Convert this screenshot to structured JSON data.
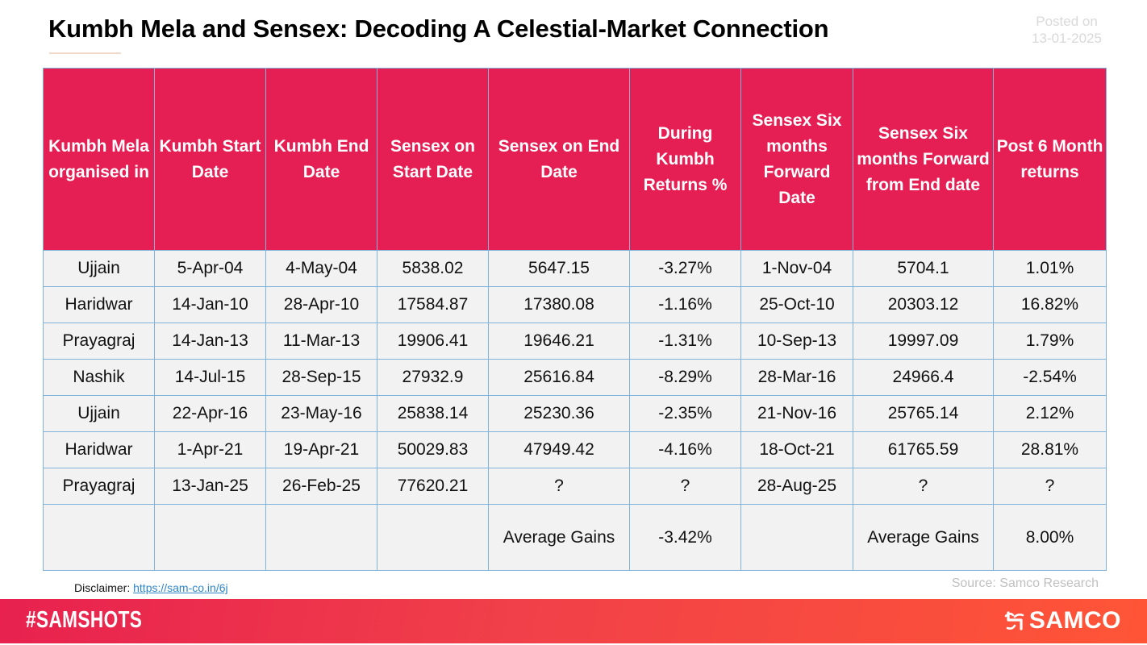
{
  "header": {
    "title": "Kumbh Mela and Sensex: Decoding A Celestial-Market Connection",
    "posted_label": "Posted on",
    "posted_date": "13-01-2025"
  },
  "table": {
    "columns": [
      "Kumbh Mela organised in",
      "Kumbh Start Date",
      "Kumbh End Date",
      "Sensex on Start Date",
      "Sensex on End Date",
      "During Kumbh Returns %",
      "Sensex Six months Forward Date",
      "Sensex Six months Forward from End date",
      "Post 6 Month returns"
    ],
    "rows": [
      [
        "Ujjain",
        "5-Apr-04",
        "4-May-04",
        "5838.02",
        "5647.15",
        "-3.27%",
        "1-Nov-04",
        "5704.1",
        "1.01%"
      ],
      [
        "Haridwar",
        "14-Jan-10",
        "28-Apr-10",
        "17584.87",
        "17380.08",
        "-1.16%",
        "25-Oct-10",
        "20303.12",
        "16.82%"
      ],
      [
        "Prayagraj",
        "14-Jan-13",
        "11-Mar-13",
        "19906.41",
        "19646.21",
        "-1.31%",
        "10-Sep-13",
        "19997.09",
        "1.79%"
      ],
      [
        "Nashik",
        "14-Jul-15",
        "28-Sep-15",
        "27932.9",
        "25616.84",
        "-8.29%",
        "28-Mar-16",
        "24966.4",
        "-2.54%"
      ],
      [
        "Ujjain",
        "22-Apr-16",
        "23-May-16",
        "25838.14",
        "25230.36",
        "-2.35%",
        "21-Nov-16",
        "25765.14",
        "2.12%"
      ],
      [
        "Haridwar",
        "1-Apr-21",
        "19-Apr-21",
        "50029.83",
        "47949.42",
        "-4.16%",
        "18-Oct-21",
        "61765.59",
        "28.81%"
      ],
      [
        "Prayagraj",
        "13-Jan-25",
        "26-Feb-25",
        "77620.21",
        "?",
        "?",
        "28-Aug-25",
        "?",
        "?"
      ]
    ],
    "summary_row": [
      "",
      "",
      "",
      "",
      "Average Gains",
      "-3.42%",
      "",
      "Average Gains",
      "8.00%"
    ]
  },
  "footer": {
    "disclaimer_label": "Disclaimer:",
    "disclaimer_link": "https://sam-co.in/6j",
    "source": "Source: Samco Research",
    "hashtag": "#SAMSHOTS",
    "brand": "SAMCO",
    "brand_icon": "samco-logo-icon"
  },
  "colors": {
    "header_bg": "#e51e54",
    "cell_bg": "#f2f2f2",
    "grid_line": "#7fb3d9",
    "footer_gradient_start": "#e8214f",
    "footer_gradient_end": "#ff5536",
    "link": "#2f86c8"
  }
}
